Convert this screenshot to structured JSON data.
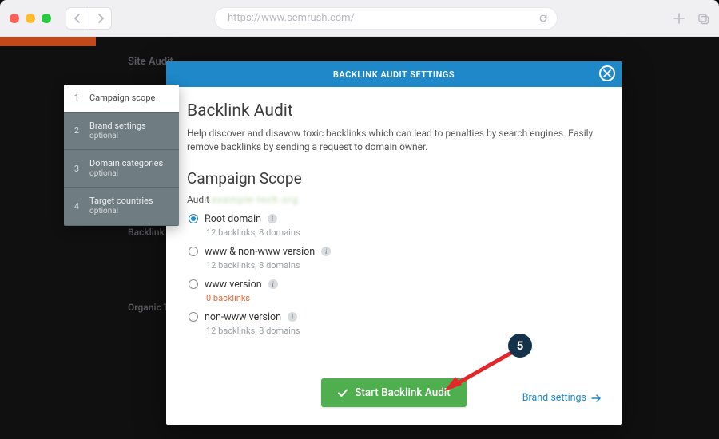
{
  "browser": {
    "url": "https://www.semrush.com/"
  },
  "stepper": [
    {
      "num": "1",
      "label": "Campaign scope",
      "optional": ""
    },
    {
      "num": "2",
      "label": "Brand settings",
      "optional": "optional"
    },
    {
      "num": "3",
      "label": "Domain categories",
      "optional": "optional"
    },
    {
      "num": "4",
      "label": "Target countries",
      "optional": "optional"
    }
  ],
  "modal": {
    "header": "BACKLINK AUDIT SETTINGS",
    "title": "Backlink Audit",
    "description": "Help discover and disavow toxic backlinks which can lead to penalties by search engines. Easily remove backlinks by sending a request to domain owner.",
    "section": "Campaign Scope",
    "audit_label": "Audit",
    "audit_domain": "example-tech.org",
    "options": [
      {
        "label": "Root domain",
        "sub": "12 backlinks, 8 domains",
        "checked": true,
        "zero": false
      },
      {
        "label": "www & non-www version",
        "sub": "12 backlinks, 8 domains",
        "checked": false,
        "zero": false
      },
      {
        "label": "www version",
        "sub": "0 backlinks",
        "checked": false,
        "zero": true
      },
      {
        "label": "non-www version",
        "sub": "12 backlinks, 8 domains",
        "checked": false,
        "zero": false
      }
    ],
    "start_button": "Start Backlink Audit",
    "next_link": "Brand settings"
  },
  "annotation": {
    "badge": "5"
  },
  "background": {
    "site_audit": "Site Audit",
    "backlink_a": "Backlink A",
    "organic": "Organic T"
  }
}
